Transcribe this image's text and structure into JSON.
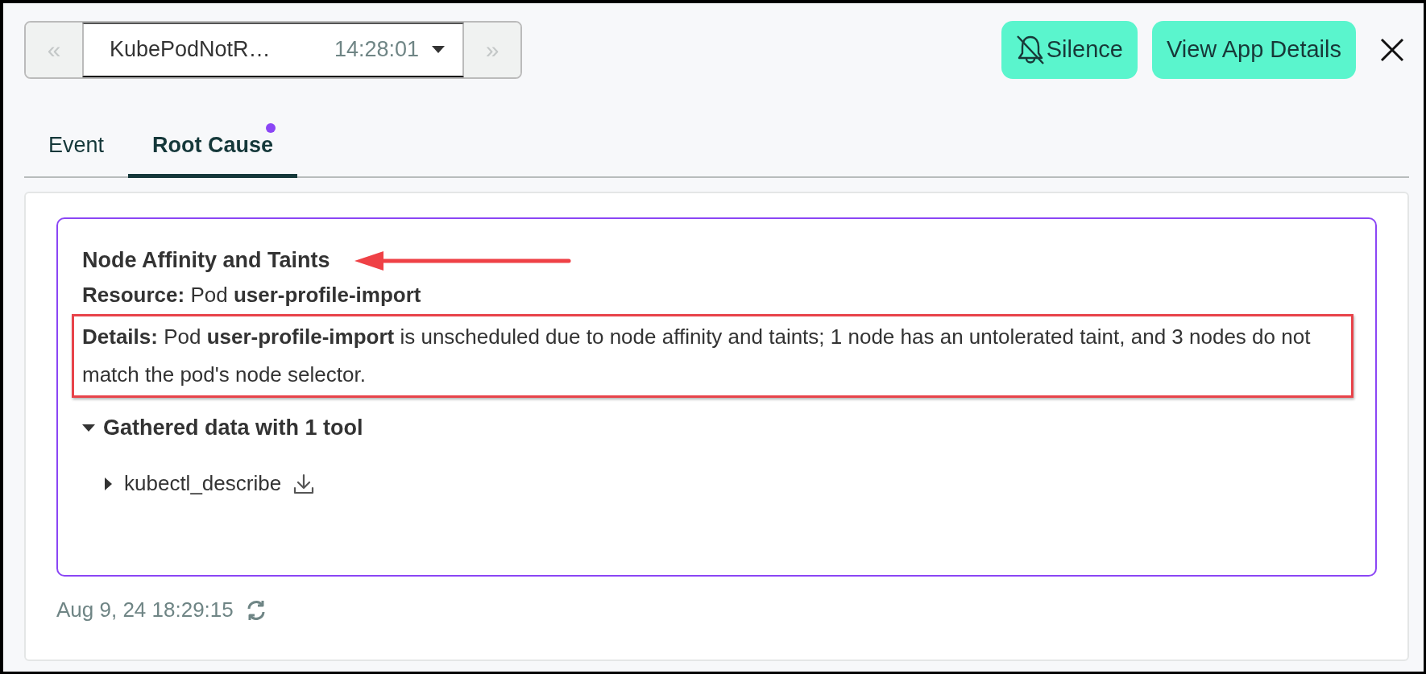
{
  "alert_selector": {
    "prev": {
      "label": "«",
      "disabled": true
    },
    "name": "KubePodNotR…",
    "time": "14:28:01",
    "next": {
      "label": "»",
      "disabled": true
    }
  },
  "actions": [
    {
      "kind": "silence",
      "label": "Silence"
    },
    {
      "kind": "plain",
      "label": "View App Details"
    }
  ],
  "tabs": [
    {
      "label": "Event",
      "selected": false,
      "dot": false
    },
    {
      "label": "Root Cause",
      "selected": true,
      "dot": true
    }
  ],
  "root_cause": {
    "title": "Node Affinity and Taints",
    "title_arrow": true,
    "resource": "**Resource:** Pod **user-profile-import**",
    "details": "**Details:** Pod **user-profile-import** is unscheduled due to node affinity and taints; 1 node has an untolerated taint, and 3 nodes do not match the pod's node selector.",
    "details_highlighted": true,
    "gathered": {
      "label": "Gathered data with 1 tool",
      "expanded": true,
      "tools": [
        {
          "name": "kubectl_describe",
          "expanded": false
        }
      ]
    }
  },
  "timestamp": "Aug 9, 24 18:29:15"
}
